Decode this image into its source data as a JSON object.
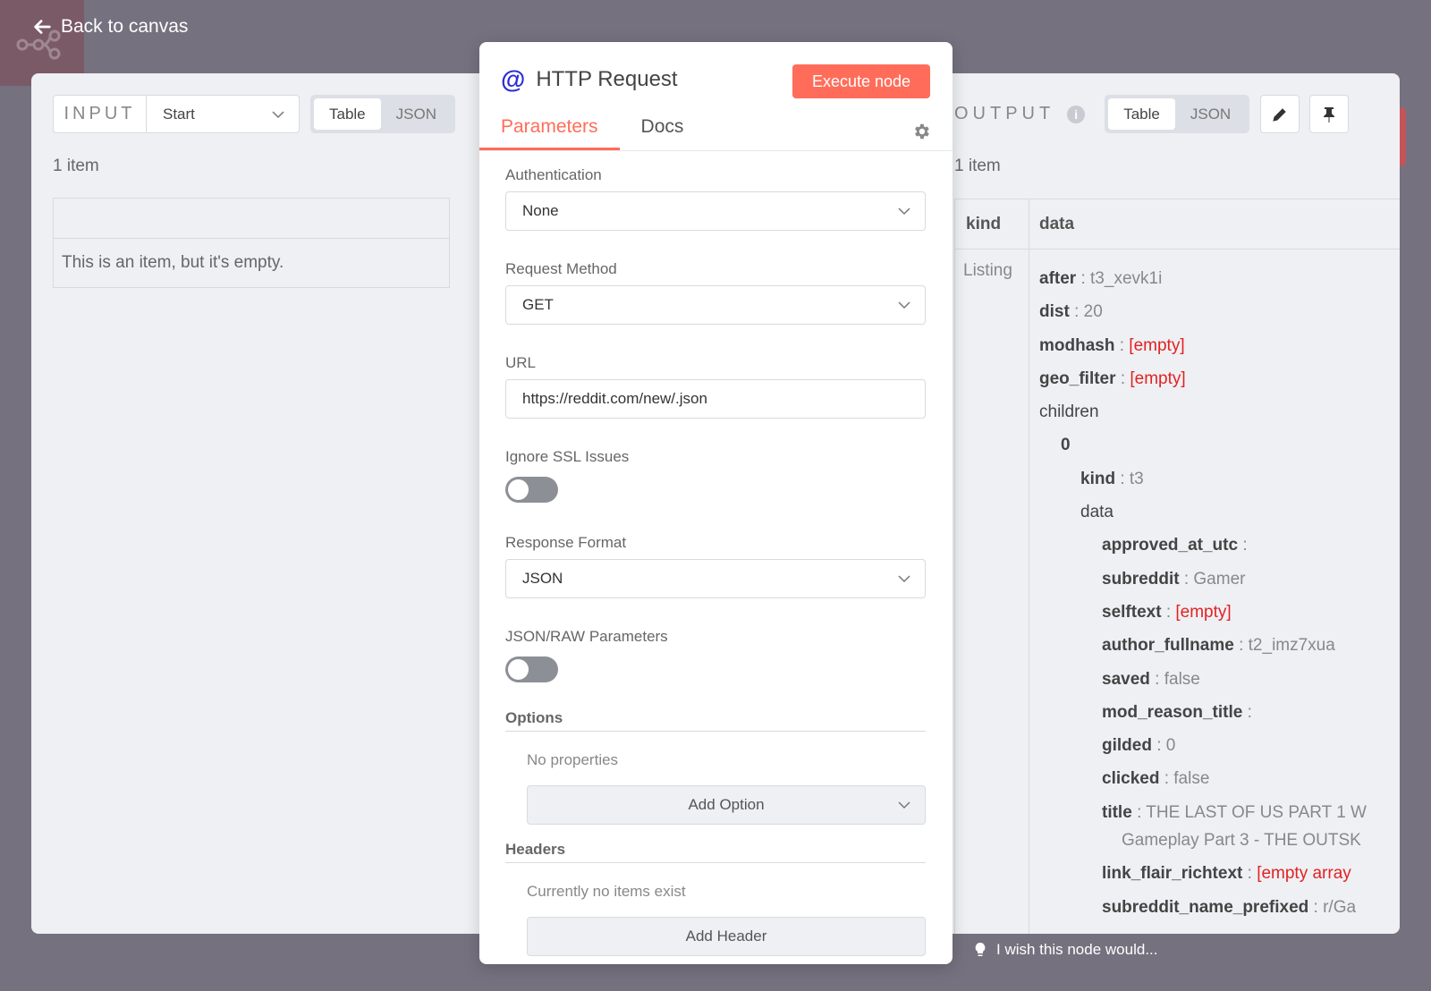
{
  "nav": {
    "back_label": "Back to canvas"
  },
  "input": {
    "label": "INPUT",
    "source": "Start",
    "view_table": "Table",
    "view_json": "JSON",
    "item_count": "1 item",
    "empty_message": "This is an item, but it's empty."
  },
  "node": {
    "title": "HTTP Request",
    "execute_label": "Execute node",
    "tabs": [
      "Parameters",
      "Docs"
    ],
    "params": {
      "authentication": {
        "label": "Authentication",
        "value": "None"
      },
      "request_method": {
        "label": "Request Method",
        "value": "GET"
      },
      "url": {
        "label": "URL",
        "value": "https://reddit.com/new/.json"
      },
      "ignore_ssl": {
        "label": "Ignore SSL Issues",
        "enabled": false
      },
      "response_format": {
        "label": "Response Format",
        "value": "JSON"
      },
      "json_raw": {
        "label": "JSON/RAW Parameters",
        "enabled": false
      },
      "options": {
        "label": "Options",
        "empty": "No properties",
        "add_label": "Add Option"
      },
      "headers": {
        "label": "Headers",
        "empty": "Currently no items exist",
        "add_label": "Add Header"
      }
    }
  },
  "output": {
    "label": "OUTPUT",
    "view_table": "Table",
    "view_json": "JSON",
    "item_count": "1 item",
    "col_kind": "kind",
    "col_data": "data",
    "kind_value": "Listing",
    "sep": ":",
    "tree": {
      "after": {
        "key": "after",
        "value": "t3_xevk1i"
      },
      "dist": {
        "key": "dist",
        "value": "20"
      },
      "modhash": {
        "key": "modhash",
        "value": "[empty]"
      },
      "geo_filter": {
        "key": "geo_filter",
        "value": "[empty]"
      },
      "children": {
        "key": "children"
      },
      "index0": {
        "key": "0"
      },
      "kind": {
        "key": "kind",
        "value": "t3"
      },
      "data": {
        "key": "data"
      },
      "approved_at_utc": {
        "key": "approved_at_utc",
        "value": ""
      },
      "subreddit": {
        "key": "subreddit",
        "value": "Gamer"
      },
      "selftext": {
        "key": "selftext",
        "value": "[empty]"
      },
      "author_fullname": {
        "key": "author_fullname",
        "value": "t2_imz7xua"
      },
      "saved": {
        "key": "saved",
        "value": "false"
      },
      "mod_reason_title": {
        "key": "mod_reason_title",
        "value": ""
      },
      "gilded": {
        "key": "gilded",
        "value": "0"
      },
      "clicked": {
        "key": "clicked",
        "value": "false"
      },
      "title": {
        "key": "title",
        "value": "THE LAST OF US PART 1 W",
        "value_cont": "Gameplay Part 3 - THE OUTSK"
      },
      "link_flair_richtext": {
        "key": "link_flair_richtext",
        "value": "[empty array"
      },
      "subreddit_name_prefixed": {
        "key": "subreddit_name_prefixed",
        "value": "r/Ga"
      }
    }
  },
  "feedback": {
    "label": "I wish this node would..."
  },
  "colors": {
    "accent": "#ff6d5a",
    "empty_value": "#e22222",
    "node_icon": "#2b2bd6"
  }
}
